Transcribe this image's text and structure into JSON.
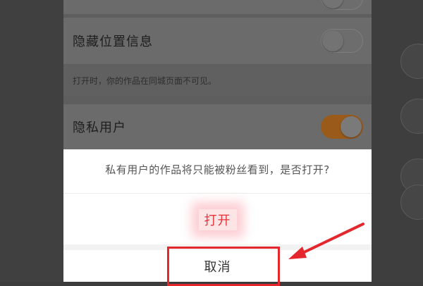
{
  "settings": {
    "hide_location": {
      "label": "隐藏位置信息",
      "state": "off"
    },
    "hint": "打开时，你的作品在同城页面不可见。",
    "private_user": {
      "label": "隐私用户",
      "state": "on"
    }
  },
  "dialog": {
    "message": "私有用户的作品将只能被粉丝看到，是否打开?",
    "open_label": "打开",
    "cancel_label": "取消"
  },
  "annotation": {
    "highlight_color": "#e4262d",
    "arrow_color": "#e4262d",
    "accent_open_color": "#e8323a",
    "toggle_on_color": "#e58a2c"
  }
}
